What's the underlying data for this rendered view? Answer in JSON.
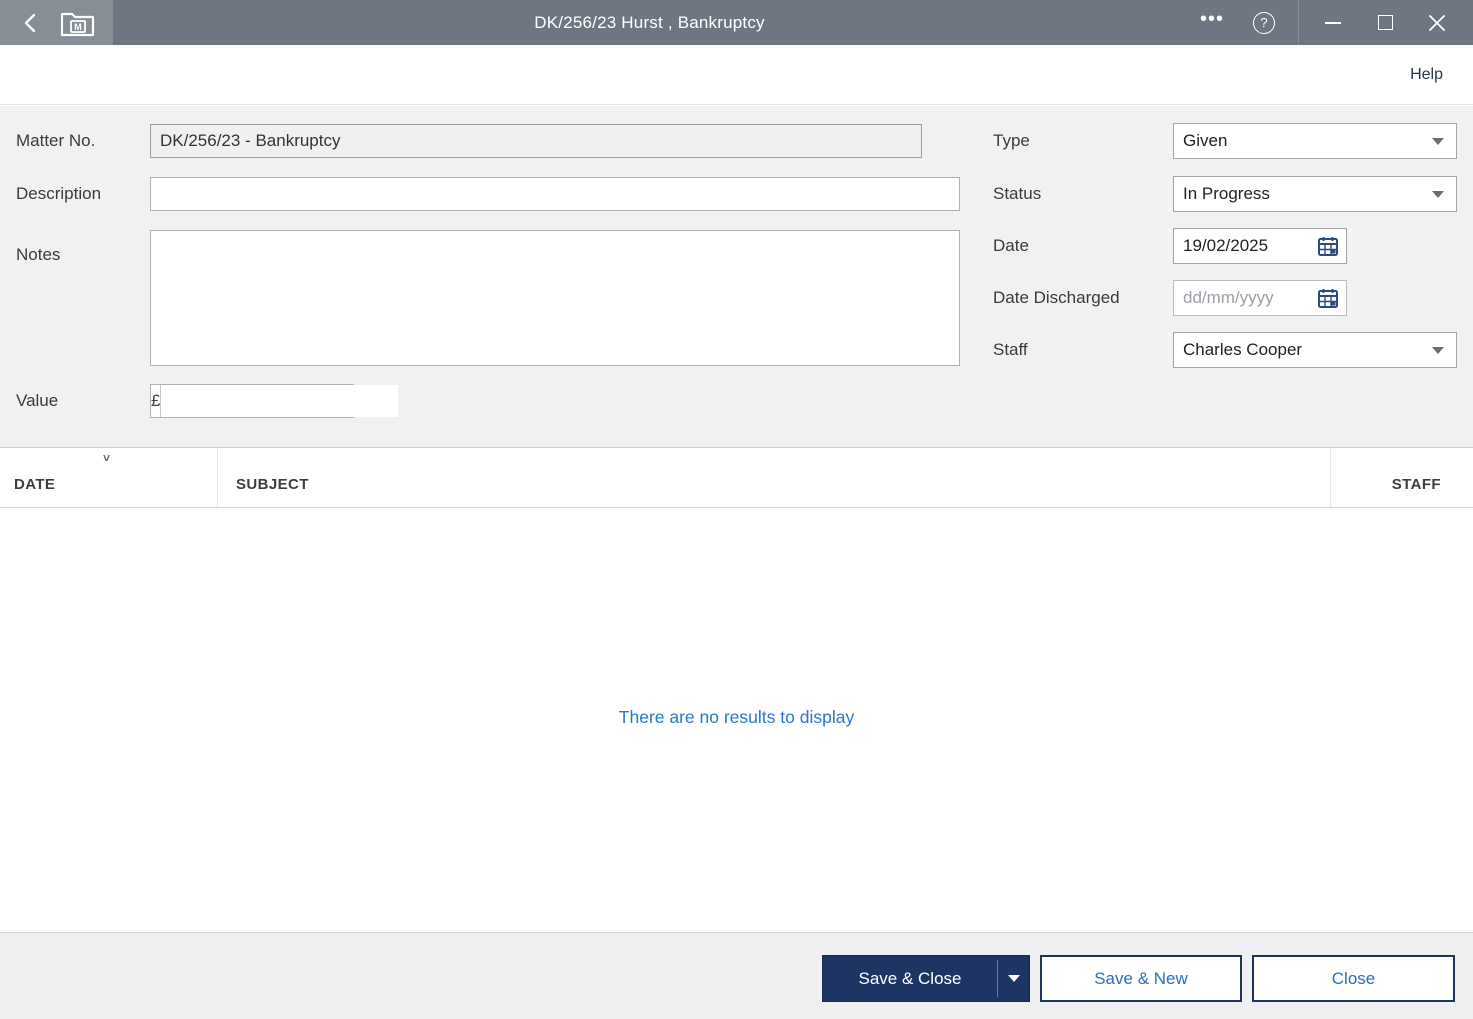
{
  "window": {
    "title": "DK/256/23 Hurst , Bankruptcy"
  },
  "toolbar": {
    "help_label": "Help"
  },
  "form": {
    "matter_no": {
      "label": "Matter No.",
      "value": "DK/256/23 - Bankruptcy"
    },
    "description": {
      "label": "Description",
      "value": ""
    },
    "notes": {
      "label": "Notes",
      "value": ""
    },
    "value": {
      "label": "Value",
      "currency_symbol": "£",
      "value": ""
    },
    "type": {
      "label": "Type",
      "value": "Given"
    },
    "status": {
      "label": "Status",
      "value": "In Progress"
    },
    "date": {
      "label": "Date",
      "value": "19/02/2025"
    },
    "date_discharged": {
      "label": "Date Discharged",
      "placeholder": "dd/mm/yyyy"
    },
    "staff": {
      "label": "Staff",
      "value": "Charles Cooper"
    }
  },
  "grid": {
    "columns": [
      "DATE",
      "SUBJECT",
      "STAFF"
    ],
    "empty_message": "There are no results to display"
  },
  "footer": {
    "save_close_label": "Save & Close",
    "save_new_label": "Save & New",
    "close_label": "Close"
  },
  "colors": {
    "titlebar": "#6d7681",
    "titlebar_left_segment": "#868e96",
    "form_background": "#f0f1f3",
    "primary_navy": "#1e3563",
    "link_blue": "#2579cf",
    "outline_button_text": "#2a6fc0"
  }
}
